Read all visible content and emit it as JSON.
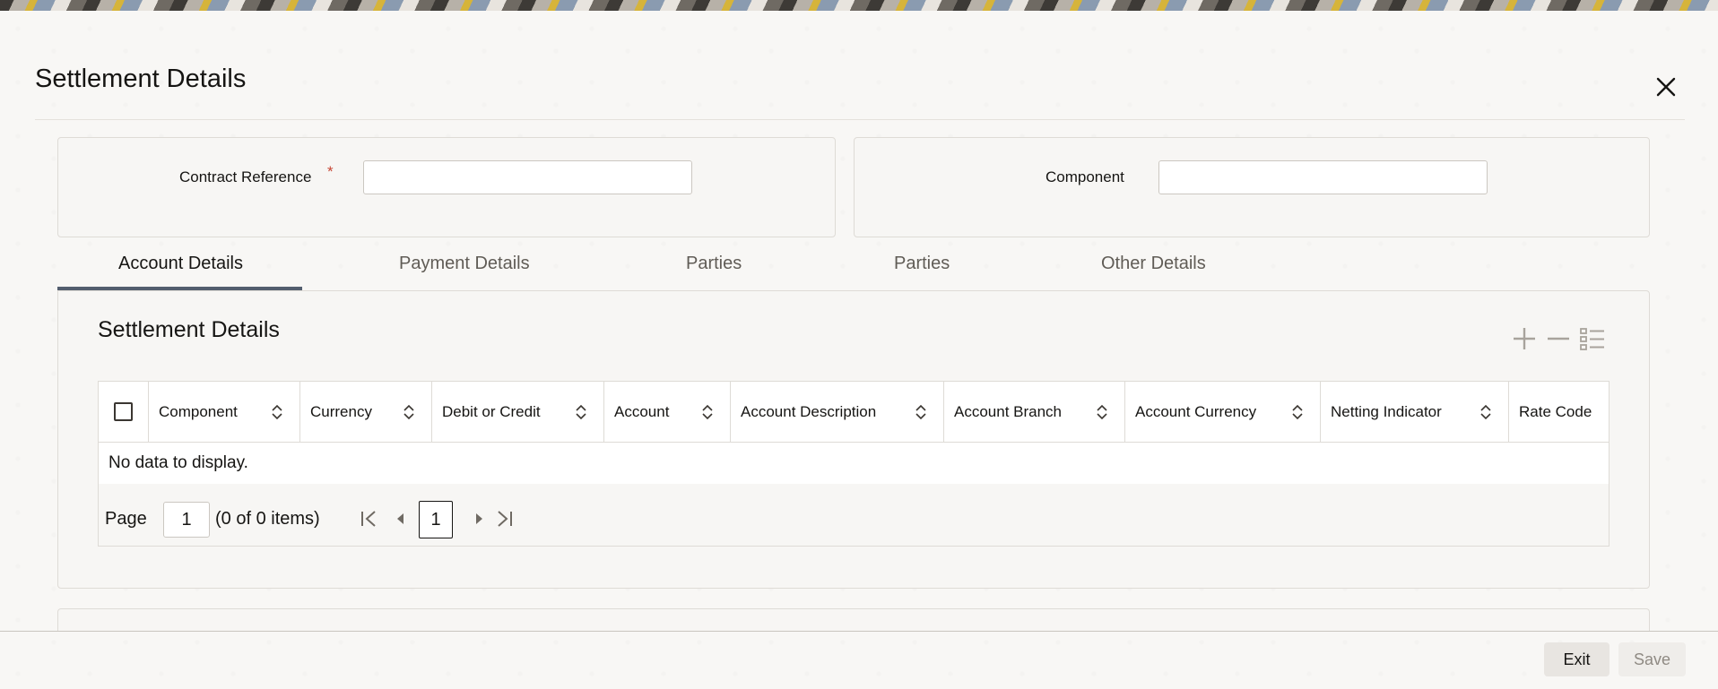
{
  "dialog": {
    "title": "Settlement Details"
  },
  "header_fields": {
    "contract_reference_label": "Contract Reference",
    "required_marker": "*",
    "component_label": "Component"
  },
  "tabs": [
    {
      "label": "Account Details",
      "active": true
    },
    {
      "label": "Payment Details",
      "active": false
    },
    {
      "label": "Parties",
      "active": false
    },
    {
      "label": "Parties",
      "active": false
    },
    {
      "label": "Other Details",
      "active": false
    }
  ],
  "section": {
    "title": "Settlement Details"
  },
  "grid": {
    "columns": [
      "Component",
      "Currency",
      "Debit or Credit",
      "Account",
      "Account Description",
      "Account Branch",
      "Account Currency",
      "Netting Indicator",
      "Rate Code"
    ],
    "empty_message": "No data to display."
  },
  "pager": {
    "page_label": "Page",
    "page_value": "1",
    "items_text": "(0 of 0 items)",
    "current_page": "1"
  },
  "footer": {
    "exit_label": "Exit",
    "save_label": "Save"
  },
  "colors": {
    "accent": "#535e6e",
    "required": "#c74634"
  },
  "icons": [
    "close-icon",
    "add-icon",
    "remove-icon",
    "list-icon",
    "sort-icon",
    "first-page-icon",
    "previous-page-icon",
    "next-page-icon",
    "last-page-icon"
  ]
}
